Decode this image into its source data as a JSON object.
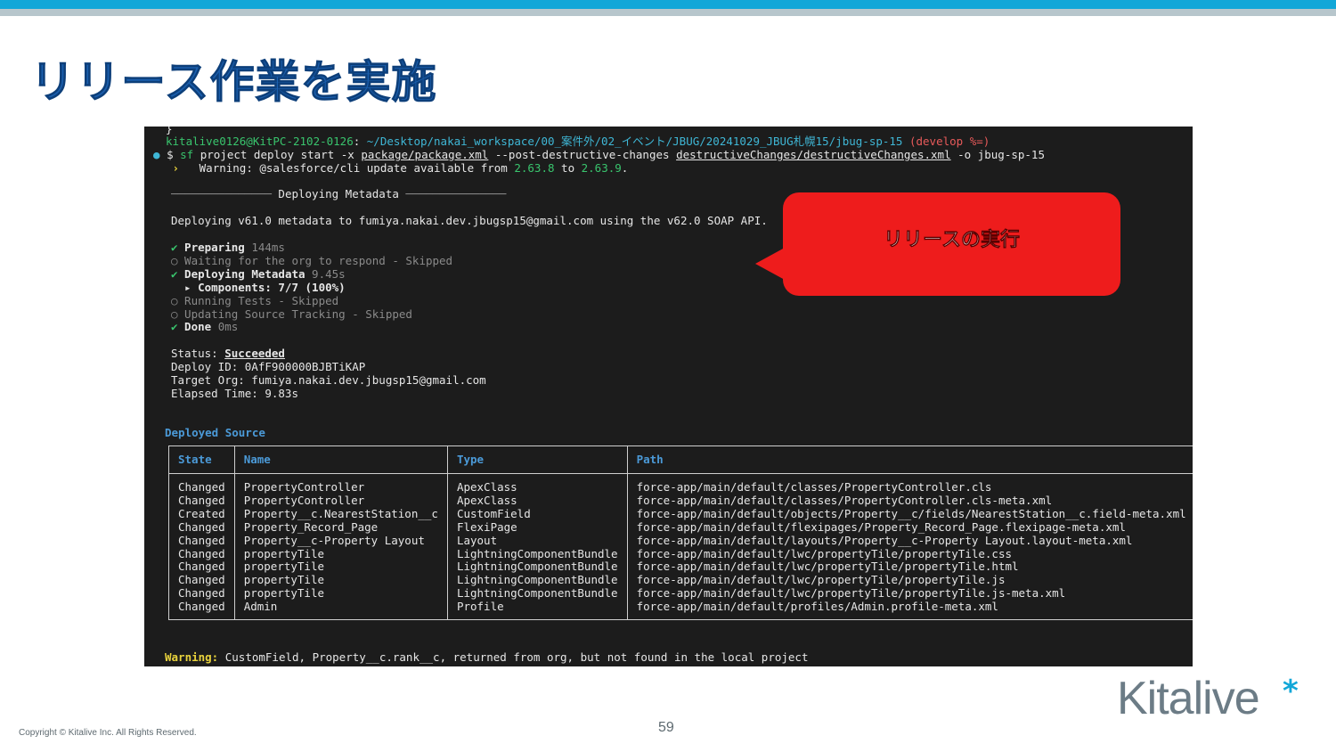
{
  "slide": {
    "title": "リリース作業を実施",
    "copyright": "Copyright © Kitalive Inc. All Rights Reserved.",
    "page_number": "59",
    "logo_text": "Kitalive",
    "logo_mark": "*"
  },
  "callout": {
    "text": "リリースの実行"
  },
  "terminal": {
    "top_brace": "}",
    "prompt_user": "kitalive0126@KitPC-2102-0126",
    "prompt_colon": ":",
    "prompt_path": " ~/Desktop/nakai_workspace/00_案件外/02_イベント/JBUG/20241029_JBUG札幌15/jbug-sp-15",
    "prompt_branch": " (develop %=)",
    "cmd_dollar": "$ ",
    "cmd_sf": "sf",
    "cmd_mid": " project deploy start -x ",
    "cmd_package": "package/package.xml",
    "cmd_mid2": " --post-destructive-changes ",
    "cmd_destructive": "destructiveChanges/destructiveChanges.xml",
    "cmd_end": " -o jbug-sp-15",
    "warn_arrow": " ›   ",
    "warn_text": "Warning: @salesforce/cli update available from ",
    "warn_from": "2.63.8",
    "warn_to_word": " to ",
    "warn_to": "2.63.9",
    "warn_dot": ".",
    "header_left": "─────────────── ",
    "header_title": "Deploying Metadata",
    "header_right": " ───────────────",
    "deploy_line": "Deploying v61.0 metadata to fumiya.nakai.dev.jbugsp15@gmail.com using the v62.0 SOAP API.",
    "steps": {
      "preparing_icon": "✔",
      "preparing_label": " Preparing ",
      "preparing_time": "144ms",
      "waiting": "○ Waiting for the org to respond - Skipped",
      "deploying_icon": "✔",
      "deploying_label": " Deploying Metadata ",
      "deploying_time": "9.45s",
      "components": "  ▸ Components: 7/7 (100%)",
      "running": "○ Running Tests - Skipped",
      "updating": "○ Updating Source Tracking - Skipped",
      "done_icon": "✔",
      "done_label": " Done ",
      "done_time": "0ms"
    },
    "status_label": "Status: ",
    "status_value": "Succeeded",
    "deploy_id": "Deploy ID: 0AfF900000BJBTiKAP",
    "target_org": "Target Org: fumiya.nakai.dev.jbugsp15@gmail.com",
    "elapsed": "Elapsed Time: 9.83s",
    "deployed_source_title": "Deployed Source",
    "table": {
      "headers": [
        "State",
        "Name",
        "Type",
        "Path"
      ],
      "rows": [
        [
          "Changed",
          "PropertyController",
          "ApexClass",
          "force-app/main/default/classes/PropertyController.cls"
        ],
        [
          "Changed",
          "PropertyController",
          "ApexClass",
          "force-app/main/default/classes/PropertyController.cls-meta.xml"
        ],
        [
          "Created",
          "Property__c.NearestStation__c",
          "CustomField",
          "force-app/main/default/objects/Property__c/fields/NearestStation__c.field-meta.xml"
        ],
        [
          "Changed",
          "Property_Record_Page",
          "FlexiPage",
          "force-app/main/default/flexipages/Property_Record_Page.flexipage-meta.xml"
        ],
        [
          "Changed",
          "Property__c-Property Layout",
          "Layout",
          "force-app/main/default/layouts/Property__c-Property Layout.layout-meta.xml"
        ],
        [
          "Changed",
          "propertyTile",
          "LightningComponentBundle",
          "force-app/main/default/lwc/propertyTile/propertyTile.css"
        ],
        [
          "Changed",
          "propertyTile",
          "LightningComponentBundle",
          "force-app/main/default/lwc/propertyTile/propertyTile.html"
        ],
        [
          "Changed",
          "propertyTile",
          "LightningComponentBundle",
          "force-app/main/default/lwc/propertyTile/propertyTile.js"
        ],
        [
          "Changed",
          "propertyTile",
          "LightningComponentBundle",
          "force-app/main/default/lwc/propertyTile/propertyTile.js-meta.xml"
        ],
        [
          "Changed",
          "Admin",
          "Profile",
          "force-app/main/default/profiles/Admin.profile-meta.xml"
        ]
      ]
    },
    "warning_label": "Warning:",
    "warning_text": " CustomField, Property__c.rank__c, returned from org, but not found in the local project"
  },
  "colors": {
    "accent_bar": "#12a7d8",
    "title_blue": "#1b5fae",
    "callout_red": "#ee1c1c",
    "terminal_bg": "#1c1c1c"
  }
}
